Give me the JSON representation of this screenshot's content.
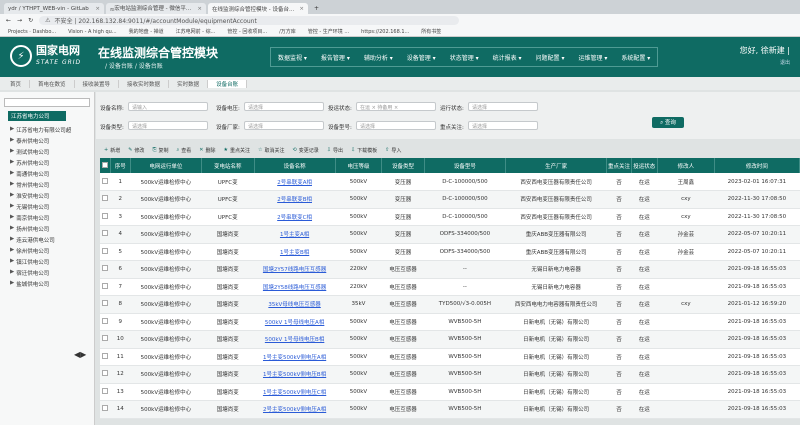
{
  "browser": {
    "tabs": [
      {
        "title": "ydr / YTHPT_WEB-vin - GitLab",
        "active": false
      },
      {
        "title": "ஐ宏电站监测综合管理 - 微信平...",
        "active": false
      },
      {
        "title": "在线监测综合管控模块 - 设备台...",
        "active": true
      }
    ],
    "url": "不安全 | 202.168.132.84:9011/#/accountModule/equipmentAccount",
    "bookmarks": [
      "Projects · Dashbo...",
      "Vision - A high qu...",
      "我的地盘 - 禅道",
      "江苏电网前 - 综...",
      "管控 - 回收项目...",
      "/万方库",
      "管控 - 生产环境 ...",
      "https://202.168.1...",
      "所有书签"
    ]
  },
  "header": {
    "logo": "⚡",
    "brand_cn": "国家电网",
    "brand_en": "STATE GRID",
    "title": "在线监测综合管控模块",
    "subtitle": "/ 设备台账 / 设备台账",
    "nav": [
      "数据监视 ▾",
      "报告管理 ▾",
      "辅助分析 ▾",
      "设备管理 ▾",
      "状态管理 ▾",
      "统计报表 ▾",
      "问题配置 ▾",
      "运维管理 ▾",
      "系统配置 ▾"
    ],
    "user": "您好, 徐新建 |",
    "user_sub": "退出"
  },
  "page_tabs": [
    "首页",
    "首电在数览",
    "接收装置导",
    "接收实时数据",
    "实时数据",
    "设备台账"
  ],
  "sidebar": {
    "root": "江苏省电力公司",
    "items": [
      "江苏省电力有限公司超",
      "泰州供电公司",
      "测试供电公司",
      "苏州供电公司",
      "南通供电公司",
      "常州供电公司",
      "淮安供电公司",
      "无锡供电公司",
      "南京供电公司",
      "扬州供电公司",
      "连云港供电公司",
      "徐州供电公司",
      "镇江供电公司",
      "宿迁供电公司",
      "盐城供电公司"
    ]
  },
  "filters": {
    "row1": [
      {
        "label": "设备名称:",
        "value": "请输入"
      },
      {
        "label": "设备电压:",
        "value": "请选择"
      },
      {
        "label": "投运状态:",
        "value": "在运 × 待备用 ×"
      },
      {
        "label": "运行状态:",
        "value": "请选择"
      }
    ],
    "row2": [
      {
        "label": "设备类型:",
        "value": "请选择"
      },
      {
        "label": "设备厂家:",
        "value": "请选择"
      },
      {
        "label": "设备型号:",
        "value": "请选择"
      },
      {
        "label": "重点关注:",
        "value": "请选择"
      }
    ],
    "query_label": "⌕ 查询"
  },
  "toolbar": [
    {
      "icon": "+",
      "label": "新增"
    },
    {
      "icon": "✎",
      "label": "修改"
    },
    {
      "icon": "⎘",
      "label": "复制"
    },
    {
      "icon": "⌕",
      "label": "查看"
    },
    {
      "icon": "✕",
      "label": "删除"
    },
    {
      "icon": "★",
      "label": "重点关注"
    },
    {
      "icon": "☆",
      "label": "取消关注"
    },
    {
      "icon": "⟲",
      "label": "变更记录"
    },
    {
      "icon": "⇩",
      "label": "导出"
    },
    {
      "icon": "⇩",
      "label": "下载模板"
    },
    {
      "icon": "⇧",
      "label": "导入"
    }
  ],
  "table": {
    "headers": [
      "序号",
      "电网运行单位",
      "变电站名称",
      "设备名称",
      "电压等级",
      "设备类型",
      "设备型号",
      "生产厂家",
      "重点关注",
      "投运状态",
      "修改人",
      "修改时间"
    ],
    "rows": [
      [
        "1",
        "500kV运维检修中心",
        "UPFC变",
        "2号串联变A相",
        "500kV",
        "变压器",
        "D-C-100000/500",
        "西安西电变压器有限责任公司",
        "否",
        "在运",
        "王周鑫",
        "2023-02-01 16:07:31"
      ],
      [
        "2",
        "500kV运维检修中心",
        "UPFC变",
        "2号串联变B相",
        "500kV",
        "变压器",
        "D-C-100000/500",
        "西安西电变压器有限责任公司",
        "否",
        "在运",
        "cxy",
        "2022-11-30 17:08:50"
      ],
      [
        "3",
        "500kV运维检修中心",
        "UPFC变",
        "2号串联变C相",
        "500kV",
        "变压器",
        "D-C-100000/500",
        "西安西电变压器有限责任公司",
        "否",
        "在运",
        "cxy",
        "2022-11-30 17:08:50"
      ],
      [
        "4",
        "500kV运维检修中心",
        "国塘尚变",
        "1号主变A相",
        "500kV",
        "变压器",
        "ODFS-334000/500",
        "重庆ABB变压器有限公司",
        "否",
        "在运",
        "孙金芸",
        "2022-05-07 10:20:11"
      ],
      [
        "5",
        "500kV运维检修中心",
        "国塘尚变",
        "1号主变B相",
        "500kV",
        "变压器",
        "ODFS-334000/500",
        "重庆ABB变压器有限公司",
        "否",
        "在运",
        "孙金芸",
        "2022-05-07 10:20:11"
      ],
      [
        "6",
        "500kV运维检修中心",
        "国塘尚变",
        "国塘2Y57线路电压互感器",
        "220kV",
        "电压互感器",
        "--",
        "无锡日新电力电容器",
        "否",
        "在运",
        "",
        "2021-09-18 16:55:03"
      ],
      [
        "7",
        "500kV运维检修中心",
        "国塘尚变",
        "国塘2Y58线路电压互感器",
        "220kV",
        "电压互感器",
        "--",
        "无锡日新电力电容器",
        "否",
        "在运",
        "",
        "2021-09-18 16:55:03"
      ],
      [
        "8",
        "500kV运维检修中心",
        "国塘尚变",
        "35kV母线电压互感器",
        "35kV",
        "电压互感器",
        "TYD500/√3-0.005H",
        "西安西电电力电容器有限责任公司",
        "否",
        "在运",
        "cxy",
        "2021-01-12 16:59:20"
      ],
      [
        "9",
        "500kV运维检修中心",
        "国塘尚变",
        "500kV 1号母线电压A相",
        "500kV",
        "电压互感器",
        "WVB500-5H",
        "日新电机（无锡）有限公司",
        "否",
        "在运",
        "",
        "2021-09-18 16:55:03"
      ],
      [
        "10",
        "500kV运维检修中心",
        "国塘尚变",
        "500kV 1号母线电压B相",
        "500kV",
        "电压互感器",
        "WVB500-5H",
        "日新电机（无锡）有限公司",
        "否",
        "在运",
        "",
        "2021-09-18 16:55:03"
      ],
      [
        "11",
        "500kV运维检修中心",
        "国塘尚变",
        "1号主变500kV侧电压A相",
        "500kV",
        "电压互感器",
        "WVB500-5H",
        "日新电机（无锡）有限公司",
        "否",
        "在运",
        "",
        "2021-09-18 16:55:03"
      ],
      [
        "12",
        "500kV运维检修中心",
        "国塘尚变",
        "1号主变500kV侧电压B相",
        "500kV",
        "电压互感器",
        "WVB500-5H",
        "日新电机（无锡）有限公司",
        "否",
        "在运",
        "",
        "2021-09-18 16:55:03"
      ],
      [
        "13",
        "500kV运维检修中心",
        "国塘尚变",
        "1号主变500kV侧电压C相",
        "500kV",
        "电压互感器",
        "WVB500-5H",
        "日新电机（无锡）有限公司",
        "否",
        "在运",
        "",
        "2021-09-18 16:55:03"
      ],
      [
        "14",
        "500kV运维检修中心",
        "国塘尚变",
        "2号主变500kV侧电压A相",
        "500kV",
        "电压互感器",
        "WVB500-5H",
        "日新电机（无锡）有限公司",
        "否",
        "在运",
        "",
        "2021-09-18 16:55:03"
      ]
    ]
  }
}
